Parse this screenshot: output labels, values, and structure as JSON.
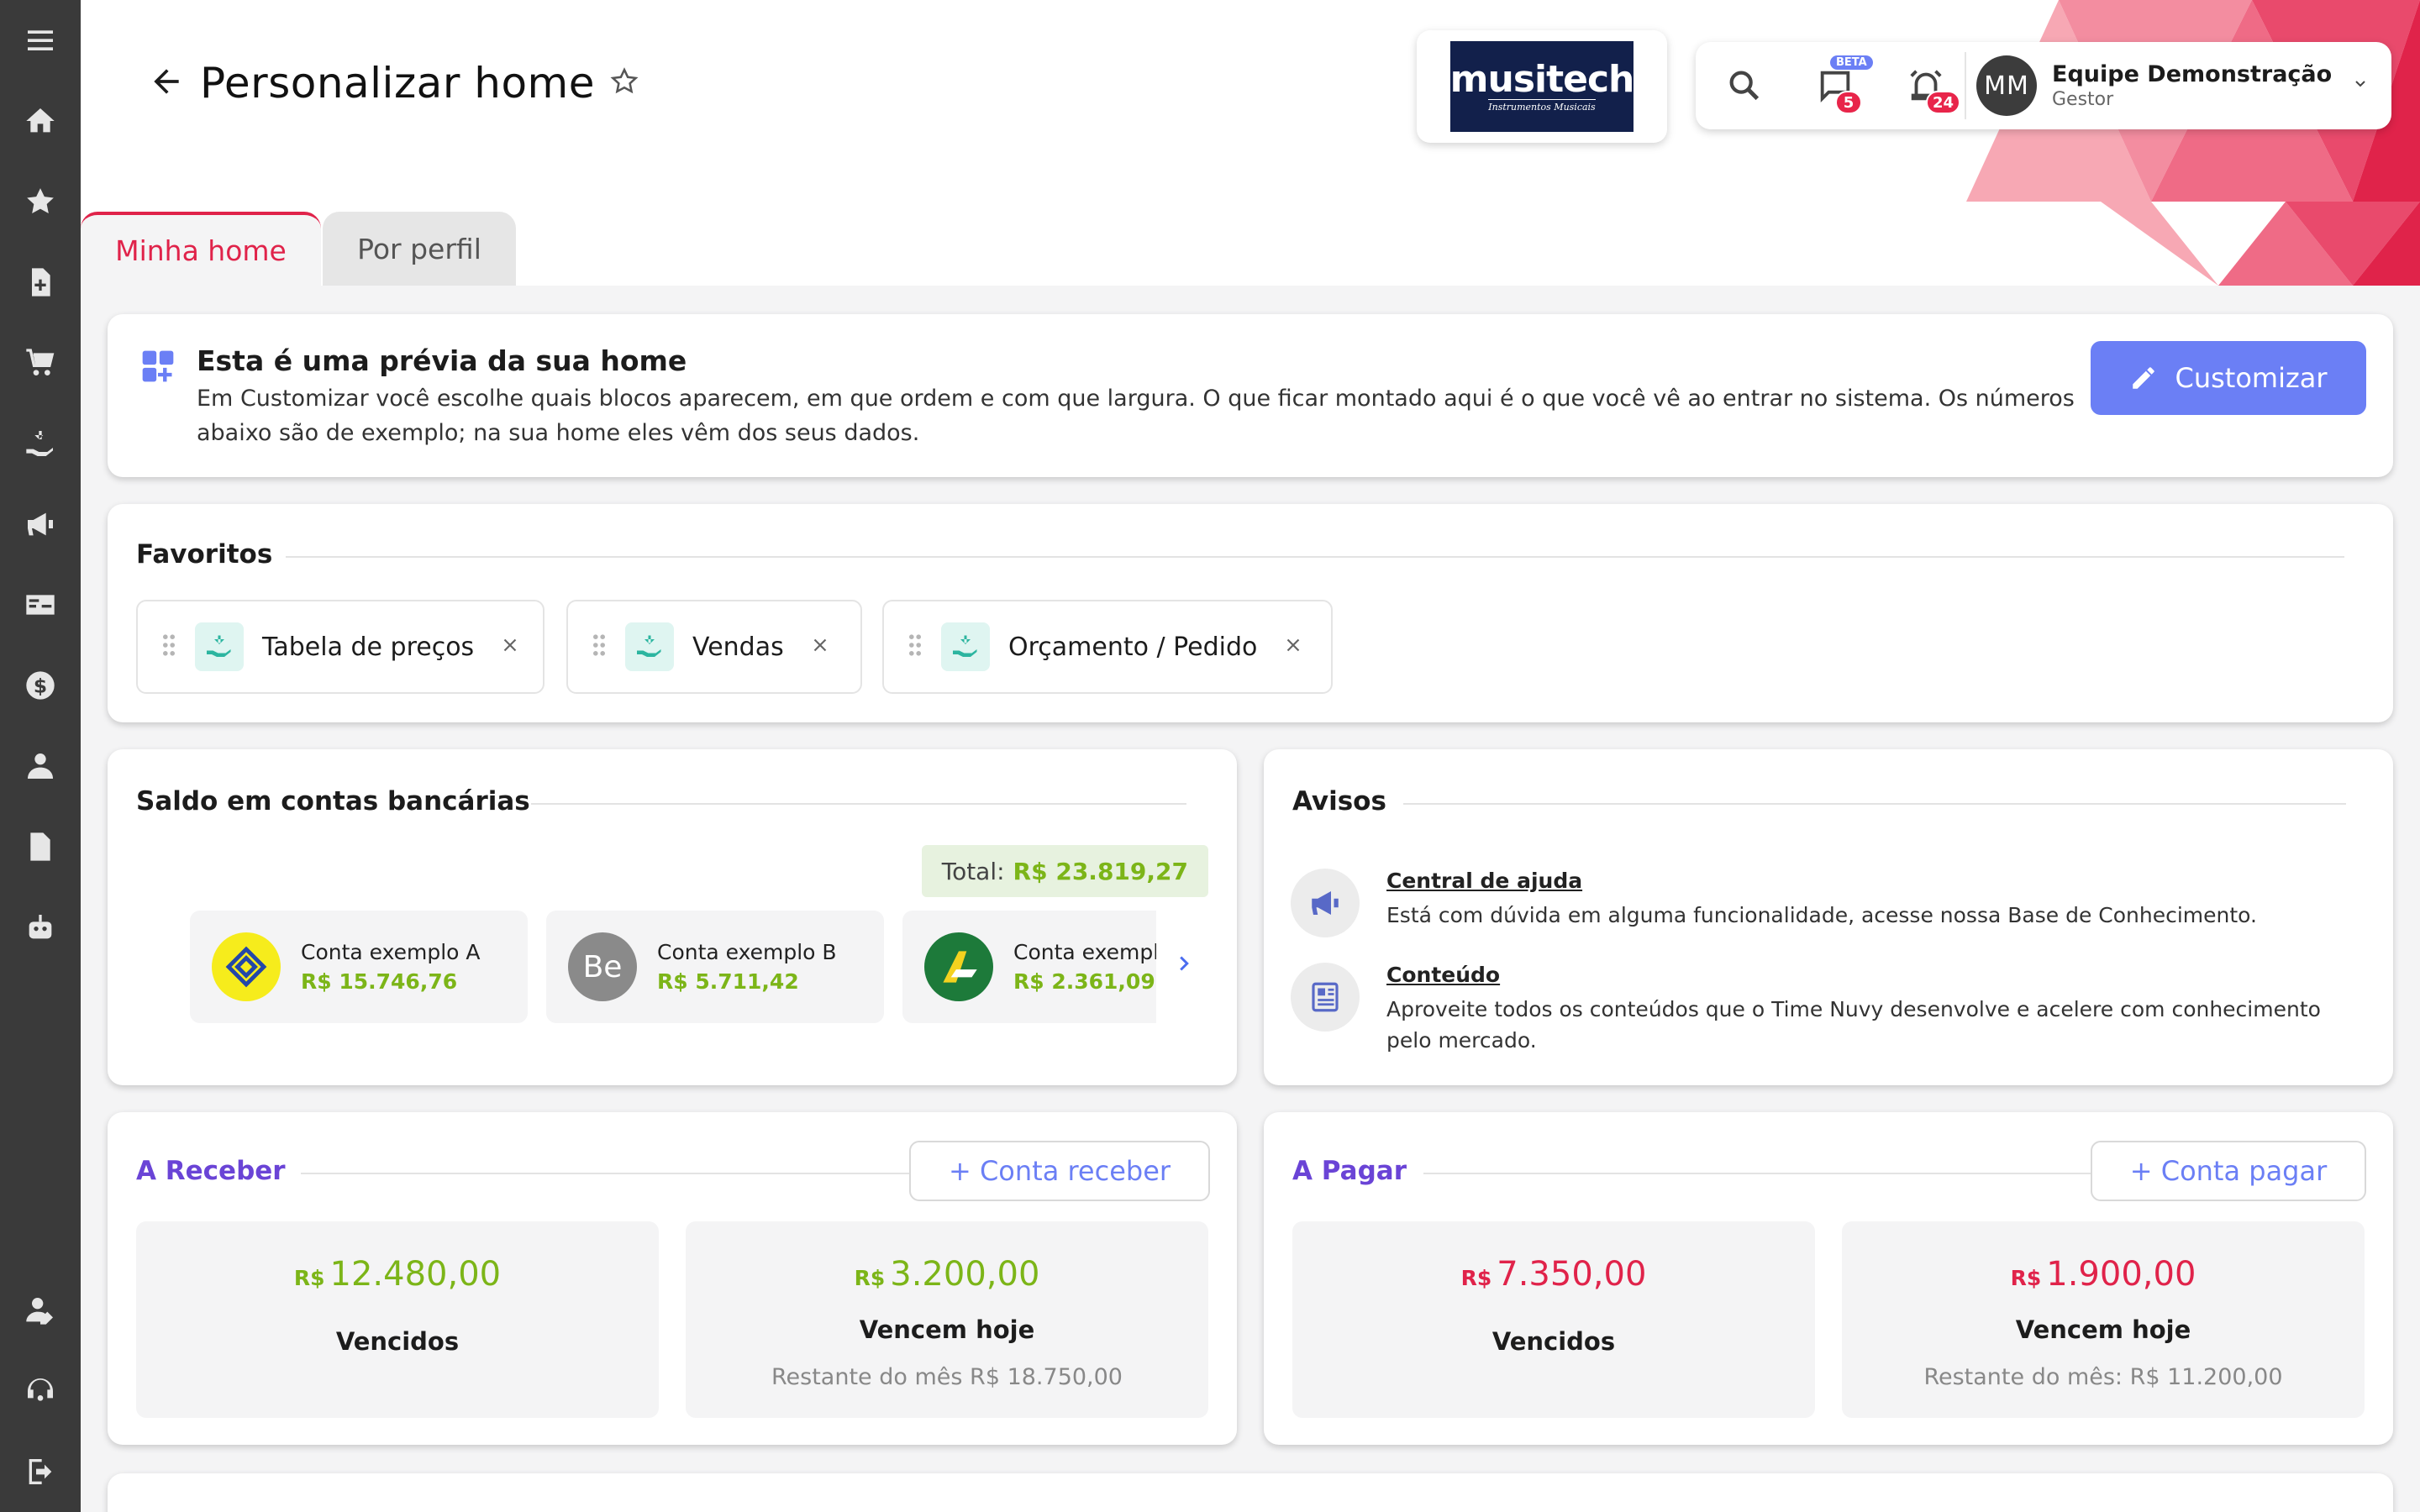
{
  "sidebar": {
    "items": [
      "menu-icon",
      "home-icon",
      "star-icon",
      "document-add-icon",
      "cart-icon",
      "sales-icon",
      "megaphone-icon",
      "card-icon",
      "dollar-icon",
      "users-icon",
      "file-icon",
      "robot-icon"
    ],
    "bottom": [
      "user-edit-icon",
      "support-icon",
      "logout-icon"
    ]
  },
  "header": {
    "title": "Personalizar home",
    "logo_main": "musitech",
    "logo_sub": "Instrumentos Musicais",
    "chat_badge": "5",
    "chat_beta": "BETA",
    "alert_badge": "24",
    "avatar_initials": "MM",
    "user_name": "Equipe Demonstração",
    "user_role": "Gestor",
    "accent": "#e0234a"
  },
  "tabs": [
    "Minha home",
    "Por perfil"
  ],
  "preview": {
    "title": "Esta é uma prévia da sua home",
    "text": "Em Customizar você escolhe quais blocos aparecem, em que ordem e com que largura. O que ficar montado aqui é o que você vê ao entrar no sistema. Os números abaixo são de exemplo; na sua home eles vêm dos seus dados.",
    "button": "Customizar"
  },
  "favorites": {
    "title": "Favoritos",
    "items": [
      "Tabela de preços",
      "Vendas",
      "Orçamento / Pedido"
    ]
  },
  "bank": {
    "title": "Saldo em contas bancárias",
    "total_label": "Total:",
    "total_value": "R$ 23.819,27",
    "accounts": [
      {
        "name": "Conta exemplo A",
        "value": "R$ 15.746,76"
      },
      {
        "name": "Conta exemplo B",
        "value": "R$ 5.711,42",
        "initials": "Be"
      },
      {
        "name": "Conta exempl",
        "value": "R$ 2.361,09"
      }
    ]
  },
  "avisos": {
    "title": "Avisos",
    "items": [
      {
        "title": "Central de ajuda",
        "text": "Está com dúvida em alguma funcionalidade, acesse nossa Base de Conhecimento."
      },
      {
        "title": "Conteúdo",
        "text": "Aproveite todos os conteúdos que o Time Nuvy desenvolve e acelere com conhecimento pelo mercado."
      }
    ]
  },
  "receber": {
    "title": "A Receber",
    "button": "+ Conta receber",
    "overdue_currency": "R$",
    "overdue_value": "12.480,00",
    "overdue_label": "Vencidos",
    "today_currency": "R$",
    "today_value": "3.200,00",
    "today_label": "Vencem hoje",
    "rest": "Restante do mês R$ 18.750,00"
  },
  "pagar": {
    "title": "A Pagar",
    "button": "+ Conta pagar",
    "overdue_currency": "R$",
    "overdue_value": "7.350,00",
    "overdue_label": "Vencidos",
    "today_currency": "R$",
    "today_value": "1.900,00",
    "today_label": "Vencem hoje",
    "rest": "Restante do mês: R$ 11.200,00"
  }
}
